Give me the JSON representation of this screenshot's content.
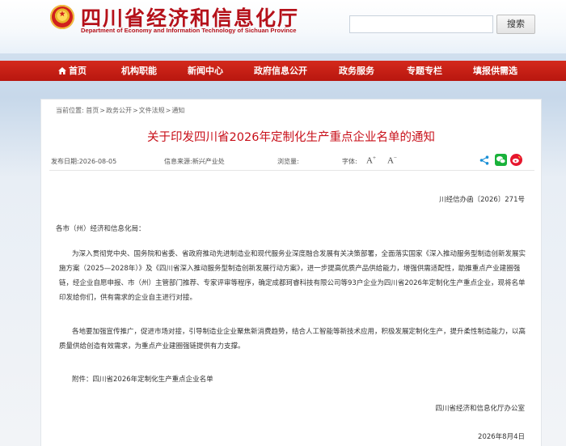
{
  "header": {
    "title": "四川省经济和信息化厅",
    "subtitle": "Department of Economy and Information Technology of Sichuan Province",
    "search_placeholder": "",
    "search_button": "搜索"
  },
  "nav": {
    "items": [
      "首页",
      "机构职能",
      "新闻中心",
      "政府信息公开",
      "政务服务",
      "专题专栏",
      "填报供需选"
    ]
  },
  "breadcrumb": {
    "prefix": "当前位置:",
    "items": [
      "首页",
      "政务公开",
      "文件法规",
      "通知"
    ],
    "sep": ">"
  },
  "article": {
    "title": "关于印发四川省2026年定制化生产重点企业名单的通知",
    "meta": {
      "publish_date": "发布日期:2026-08-05",
      "source": "信息来源:新兴产业处",
      "views": "浏览量:",
      "font_label": "字体:",
      "font_up": "A",
      "font_down": "A"
    },
    "doc_number": "川经信办函〔2026〕271号",
    "salutation": "各市（州）经济和信息化局：",
    "paragraph1": "为深入贯彻党中央、国务院和省委、省政府推动先进制造业和现代服务业深度融合发展有关决策部署，全面落实国家《深入推动服务型制造创新发展实施方案（2025—2028年）》及《四川省深入推动服务型制造创新发展行动方案》，进一步提高优质产品供给能力，增强供需适配性，助推重点产业建圈强链，经企业自愿申报、市（州）主管部门推荐、专家评审等程序，确定成都珂睿科技有限公司等93户企业为四川省2026年定制化生产重点企业，现将名单印发给你们，供有需求的企业自主进行对接。",
    "paragraph2": "各地要加强宣传推广，促进市场对接，引导制造业企业聚焦新消费趋势，结合人工智能等新技术应用，积极发展定制化生产，提升柔性制造能力，以高质量供给创造有效需求，为重点产业建圈强链提供有力支撑。",
    "attachment": "附件：四川省2026年定制化生产重点企业名单",
    "signature_org": "四川省经济和信息化厅办公室",
    "signature_date": "2026年8月4日"
  },
  "colors": {
    "brand_red": "#b5111a",
    "nav_red": "#c81e15",
    "title_red": "#c8101a"
  }
}
